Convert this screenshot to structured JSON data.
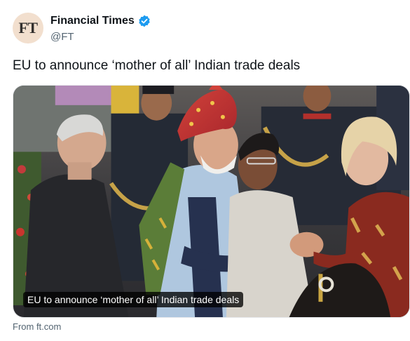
{
  "account": {
    "avatar_text": "FT",
    "display_name": "Financial Times",
    "handle": "@FT",
    "verified": true,
    "verified_color": "#1d9bf0",
    "avatar_bg": "#f2dfce"
  },
  "tweet": {
    "text": "EU to announce ‘mother of all’ Indian trade deals"
  },
  "card": {
    "caption": "EU to announce ‘mother of all’ Indian trade deals",
    "source": "From ft.com"
  }
}
